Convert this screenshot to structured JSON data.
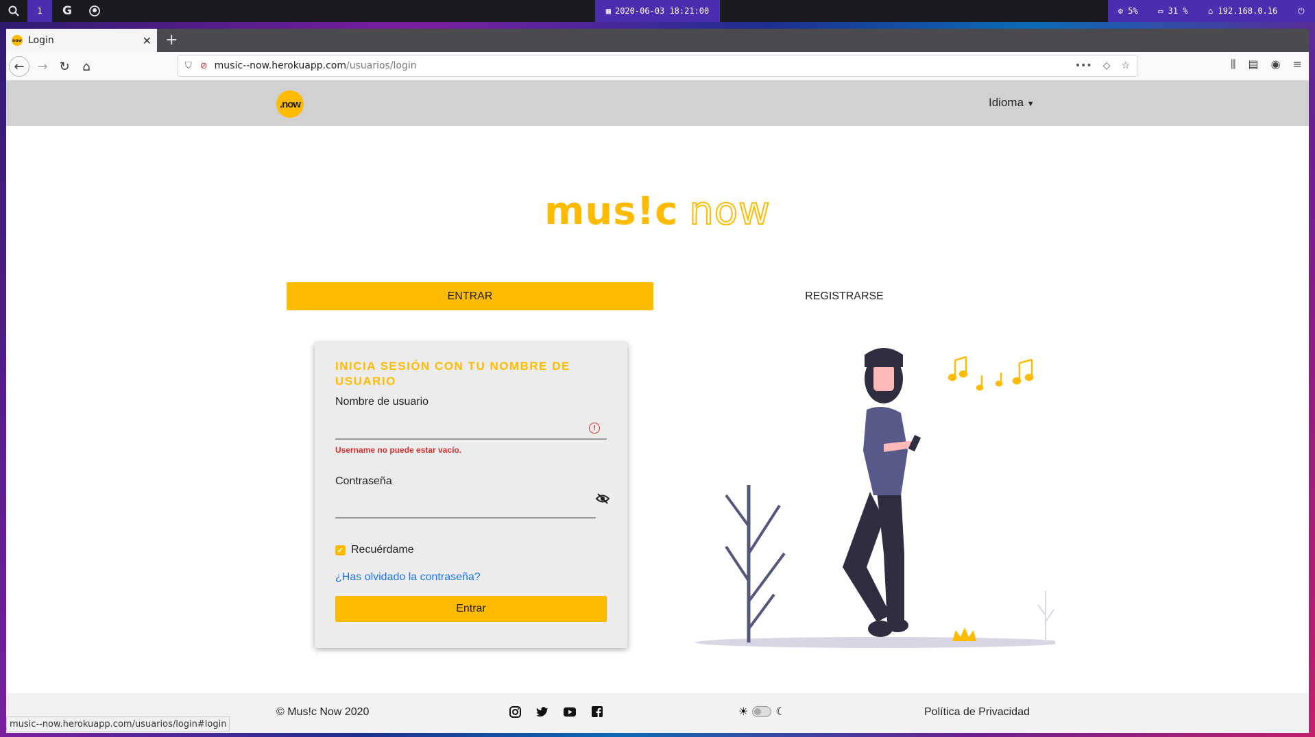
{
  "os_bar": {
    "workspace": "1",
    "clock": "2020-06-03 18:21:00",
    "cpu": "5%",
    "disk": "31 %",
    "ip": "192.168.0.16"
  },
  "browser": {
    "tab_title": "Login",
    "url_host": "music--now.herokuapp.com",
    "url_path": "/usuarios/login",
    "status_url": "music--now.herokuapp.com/usuarios/login#login"
  },
  "header": {
    "logo_text": ".now",
    "language_label": "Idioma"
  },
  "brand": {
    "solid": "mus!c",
    "outline": "now"
  },
  "tabs": {
    "login": "ENTRAR",
    "register": "REGISTRARSE"
  },
  "form": {
    "title": "INICIA SESIÓN CON TU NOMBRE DE USUARIO",
    "username_label": "Nombre de usuario",
    "username_value": "",
    "username_error": "Username no puede estar vacío.",
    "password_label": "Contraseña",
    "password_value": "",
    "remember_label": "Recuérdame",
    "forgot_link": "¿Has olvidado la contraseña?",
    "submit_label": "Entrar"
  },
  "footer": {
    "copyright": "© Mus!c Now 2020",
    "privacy": "Política de Privacidad"
  },
  "colors": {
    "accent": "#ffbb00",
    "error": "#d32f2f",
    "link": "#1a73e8"
  }
}
